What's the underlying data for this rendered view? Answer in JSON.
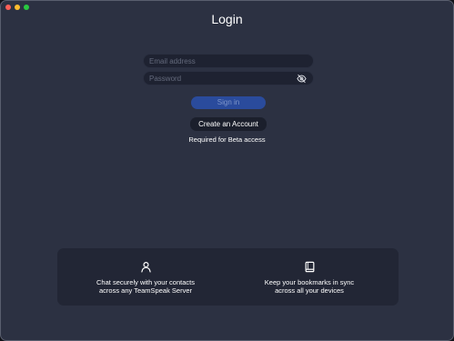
{
  "window": {
    "title": "Login"
  },
  "form": {
    "email_placeholder": "Email address",
    "password_placeholder": "Password",
    "password_toggle_icon": "eye-slash-icon",
    "signin_label": "Sign in",
    "create_account_label": "Create an Account",
    "note": "Required for Beta access"
  },
  "features": [
    {
      "icon": "person-icon",
      "line1": "Chat securely with your contacts",
      "line2": "across any TeamSpeak Server"
    },
    {
      "icon": "book-icon",
      "line1": "Keep your bookmarks in sync",
      "line2": "across all your devices"
    }
  ],
  "colors": {
    "background": "#2c3142",
    "field": "#1e2231",
    "signin_button": "#2a4b9c",
    "create_button": "#1b1f2c",
    "panel": "#222635"
  }
}
